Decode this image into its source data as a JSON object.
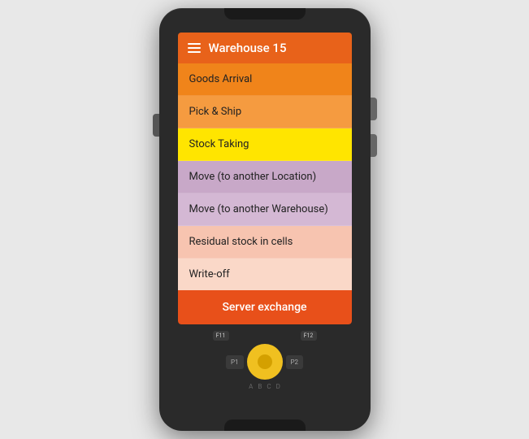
{
  "header": {
    "title": "Warehouse 15"
  },
  "menu": {
    "items": [
      {
        "id": "goods-arrival",
        "label": "Goods Arrival",
        "class": "item-goods-arrival"
      },
      {
        "id": "pick-ship",
        "label": "Pick & Ship",
        "class": "item-pick-ship"
      },
      {
        "id": "stock-taking",
        "label": "Stock Taking",
        "class": "item-stock-taking"
      },
      {
        "id": "move-location",
        "label": "Move (to another Location)",
        "class": "item-move-location"
      },
      {
        "id": "move-warehouse",
        "label": "Move (to another Warehouse)",
        "class": "item-move-warehouse"
      },
      {
        "id": "residual-stock",
        "label": "Residual stock in cells",
        "class": "item-residual"
      },
      {
        "id": "write-off",
        "label": "Write-off",
        "class": "item-writeoff"
      }
    ],
    "server_button": "Server exchange"
  },
  "keypad": {
    "fn_keys": [
      "F11",
      "F12"
    ],
    "p_keys": [
      "P1",
      "P2"
    ],
    "bottom_letters": [
      "A",
      "B",
      "C",
      "D"
    ]
  }
}
